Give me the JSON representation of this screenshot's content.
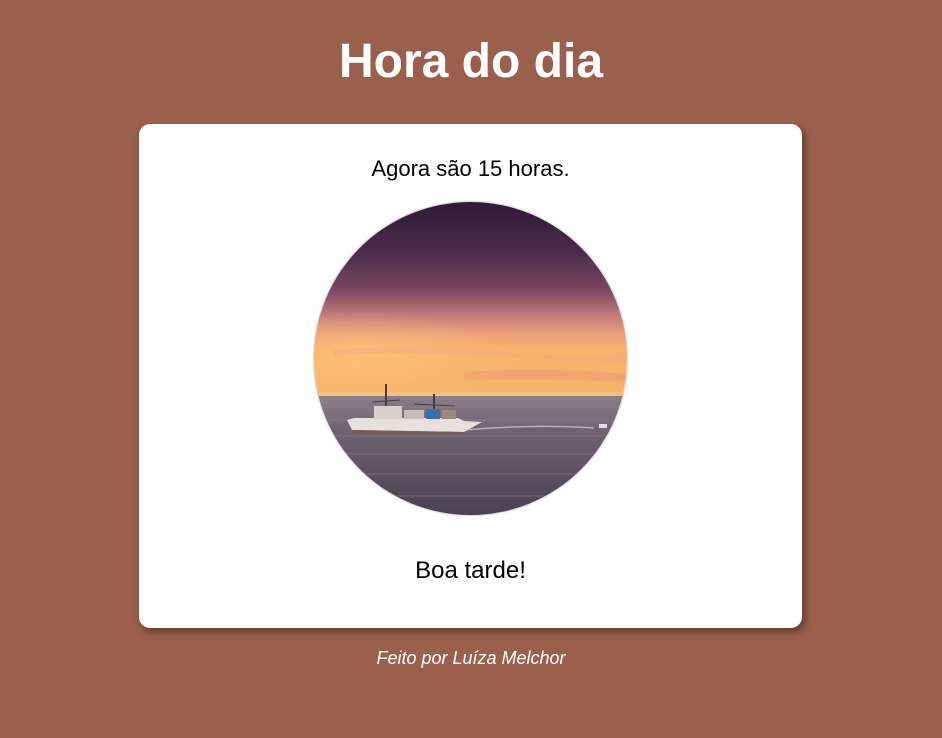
{
  "page": {
    "title": "Hora do dia",
    "background_color": "#9a604c"
  },
  "card": {
    "time_message": "Agora são 15 horas.",
    "image": {
      "subject": "fishing boat on the sea at sunset"
    },
    "greeting": "Boa tarde!"
  },
  "footer": {
    "credit": "Feito por Luíza Melchor"
  }
}
